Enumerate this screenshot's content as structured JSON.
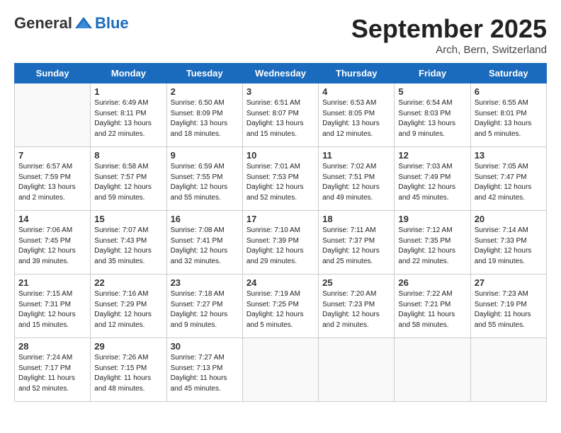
{
  "header": {
    "logo_general": "General",
    "logo_blue": "Blue",
    "month_title": "September 2025",
    "subtitle": "Arch, Bern, Switzerland"
  },
  "days_of_week": [
    "Sunday",
    "Monday",
    "Tuesday",
    "Wednesday",
    "Thursday",
    "Friday",
    "Saturday"
  ],
  "weeks": [
    [
      {
        "day": "",
        "info": ""
      },
      {
        "day": "1",
        "info": "Sunrise: 6:49 AM\nSunset: 8:11 PM\nDaylight: 13 hours\nand 22 minutes."
      },
      {
        "day": "2",
        "info": "Sunrise: 6:50 AM\nSunset: 8:09 PM\nDaylight: 13 hours\nand 18 minutes."
      },
      {
        "day": "3",
        "info": "Sunrise: 6:51 AM\nSunset: 8:07 PM\nDaylight: 13 hours\nand 15 minutes."
      },
      {
        "day": "4",
        "info": "Sunrise: 6:53 AM\nSunset: 8:05 PM\nDaylight: 13 hours\nand 12 minutes."
      },
      {
        "day": "5",
        "info": "Sunrise: 6:54 AM\nSunset: 8:03 PM\nDaylight: 13 hours\nand 9 minutes."
      },
      {
        "day": "6",
        "info": "Sunrise: 6:55 AM\nSunset: 8:01 PM\nDaylight: 13 hours\nand 5 minutes."
      }
    ],
    [
      {
        "day": "7",
        "info": "Sunrise: 6:57 AM\nSunset: 7:59 PM\nDaylight: 13 hours\nand 2 minutes."
      },
      {
        "day": "8",
        "info": "Sunrise: 6:58 AM\nSunset: 7:57 PM\nDaylight: 12 hours\nand 59 minutes."
      },
      {
        "day": "9",
        "info": "Sunrise: 6:59 AM\nSunset: 7:55 PM\nDaylight: 12 hours\nand 55 minutes."
      },
      {
        "day": "10",
        "info": "Sunrise: 7:01 AM\nSunset: 7:53 PM\nDaylight: 12 hours\nand 52 minutes."
      },
      {
        "day": "11",
        "info": "Sunrise: 7:02 AM\nSunset: 7:51 PM\nDaylight: 12 hours\nand 49 minutes."
      },
      {
        "day": "12",
        "info": "Sunrise: 7:03 AM\nSunset: 7:49 PM\nDaylight: 12 hours\nand 45 minutes."
      },
      {
        "day": "13",
        "info": "Sunrise: 7:05 AM\nSunset: 7:47 PM\nDaylight: 12 hours\nand 42 minutes."
      }
    ],
    [
      {
        "day": "14",
        "info": "Sunrise: 7:06 AM\nSunset: 7:45 PM\nDaylight: 12 hours\nand 39 minutes."
      },
      {
        "day": "15",
        "info": "Sunrise: 7:07 AM\nSunset: 7:43 PM\nDaylight: 12 hours\nand 35 minutes."
      },
      {
        "day": "16",
        "info": "Sunrise: 7:08 AM\nSunset: 7:41 PM\nDaylight: 12 hours\nand 32 minutes."
      },
      {
        "day": "17",
        "info": "Sunrise: 7:10 AM\nSunset: 7:39 PM\nDaylight: 12 hours\nand 29 minutes."
      },
      {
        "day": "18",
        "info": "Sunrise: 7:11 AM\nSunset: 7:37 PM\nDaylight: 12 hours\nand 25 minutes."
      },
      {
        "day": "19",
        "info": "Sunrise: 7:12 AM\nSunset: 7:35 PM\nDaylight: 12 hours\nand 22 minutes."
      },
      {
        "day": "20",
        "info": "Sunrise: 7:14 AM\nSunset: 7:33 PM\nDaylight: 12 hours\nand 19 minutes."
      }
    ],
    [
      {
        "day": "21",
        "info": "Sunrise: 7:15 AM\nSunset: 7:31 PM\nDaylight: 12 hours\nand 15 minutes."
      },
      {
        "day": "22",
        "info": "Sunrise: 7:16 AM\nSunset: 7:29 PM\nDaylight: 12 hours\nand 12 minutes."
      },
      {
        "day": "23",
        "info": "Sunrise: 7:18 AM\nSunset: 7:27 PM\nDaylight: 12 hours\nand 9 minutes."
      },
      {
        "day": "24",
        "info": "Sunrise: 7:19 AM\nSunset: 7:25 PM\nDaylight: 12 hours\nand 5 minutes."
      },
      {
        "day": "25",
        "info": "Sunrise: 7:20 AM\nSunset: 7:23 PM\nDaylight: 12 hours\nand 2 minutes."
      },
      {
        "day": "26",
        "info": "Sunrise: 7:22 AM\nSunset: 7:21 PM\nDaylight: 11 hours\nand 58 minutes."
      },
      {
        "day": "27",
        "info": "Sunrise: 7:23 AM\nSunset: 7:19 PM\nDaylight: 11 hours\nand 55 minutes."
      }
    ],
    [
      {
        "day": "28",
        "info": "Sunrise: 7:24 AM\nSunset: 7:17 PM\nDaylight: 11 hours\nand 52 minutes."
      },
      {
        "day": "29",
        "info": "Sunrise: 7:26 AM\nSunset: 7:15 PM\nDaylight: 11 hours\nand 48 minutes."
      },
      {
        "day": "30",
        "info": "Sunrise: 7:27 AM\nSunset: 7:13 PM\nDaylight: 11 hours\nand 45 minutes."
      },
      {
        "day": "",
        "info": ""
      },
      {
        "day": "",
        "info": ""
      },
      {
        "day": "",
        "info": ""
      },
      {
        "day": "",
        "info": ""
      }
    ]
  ]
}
